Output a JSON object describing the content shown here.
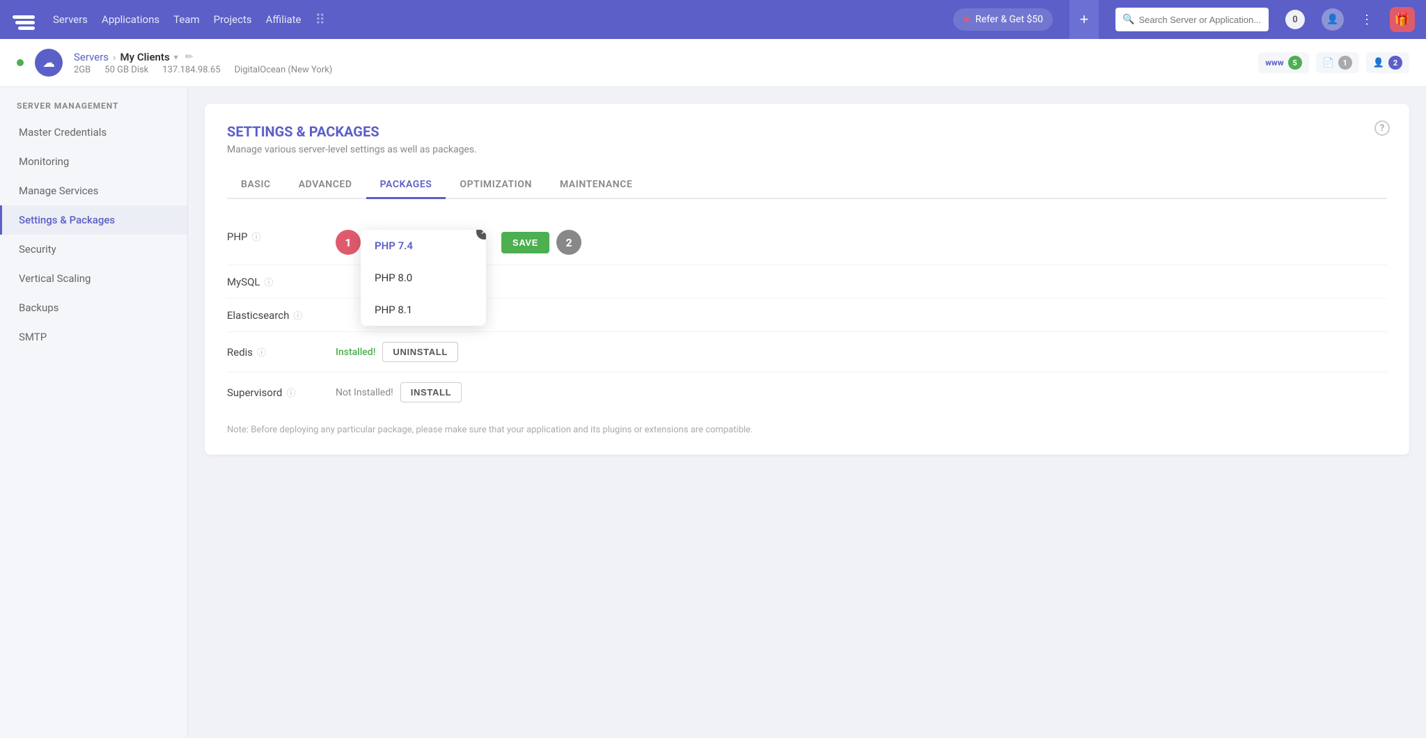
{
  "topnav": {
    "logo_icon": "cloud-icon",
    "links": [
      "Servers",
      "Applications",
      "Team",
      "Projects",
      "Affiliate"
    ],
    "refer_label": "Refer & Get $50",
    "plus_icon": "+",
    "search_placeholder": "Search Server or Application...",
    "notification_count": "0",
    "dots_icon": "⋮",
    "gift_icon": "🎁"
  },
  "server_bar": {
    "breadcrumb_servers": "Servers",
    "breadcrumb_name": "My Clients",
    "disk": "50 GB Disk",
    "ram": "2GB",
    "ip": "137.184.98.65",
    "provider": "DigitalOcean (New York)",
    "badges": [
      {
        "icon": "www",
        "count": "5",
        "color": "green"
      },
      {
        "icon": "📄",
        "count": "1",
        "color": "gray"
      },
      {
        "icon": "👤",
        "count": "2",
        "color": "blue"
      }
    ]
  },
  "sidebar": {
    "section_title": "Server Management",
    "items": [
      {
        "label": "Master Credentials",
        "active": false
      },
      {
        "label": "Monitoring",
        "active": false
      },
      {
        "label": "Manage Services",
        "active": false
      },
      {
        "label": "Settings & Packages",
        "active": true
      },
      {
        "label": "Security",
        "active": false
      },
      {
        "label": "Vertical Scaling",
        "active": false
      },
      {
        "label": "Backups",
        "active": false
      },
      {
        "label": "SMTP",
        "active": false
      }
    ]
  },
  "content": {
    "title": "SETTINGS & PACKAGES",
    "subtitle": "Manage various server-level settings as well as packages.",
    "tabs": [
      {
        "label": "BASIC",
        "active": false
      },
      {
        "label": "ADVANCED",
        "active": false
      },
      {
        "label": "PACKAGES",
        "active": true
      },
      {
        "label": "OPTIMIZATION",
        "active": false
      },
      {
        "label": "MAINTENANCE",
        "active": false
      }
    ],
    "packages": [
      {
        "name": "PHP",
        "has_info": true,
        "type": "dropdown",
        "step1": "1",
        "step2": "2",
        "dropdown_options": [
          "PHP 7.4",
          "PHP 8.0",
          "PHP 8.1"
        ],
        "dropdown_selected": "PHP 7.4",
        "dropdown_open": true,
        "save_label": "SAVE"
      },
      {
        "name": "MySQL",
        "has_info": true,
        "type": "dropdown",
        "dropdown_open": false
      },
      {
        "name": "Elasticsearch",
        "has_info": true,
        "type": "dropdown",
        "dropdown_open": false
      },
      {
        "name": "Redis",
        "has_info": true,
        "type": "install",
        "status": "installed",
        "status_label": "Installed!",
        "action_label": "UNINSTALL"
      },
      {
        "name": "Supervisord",
        "has_info": true,
        "type": "install",
        "status": "not_installed",
        "status_label": "Not Installed!",
        "action_label": "INSTALL"
      }
    ],
    "note": "Note: Before deploying any particular package, please make sure that your application and its plugins or extensions are compatible."
  }
}
